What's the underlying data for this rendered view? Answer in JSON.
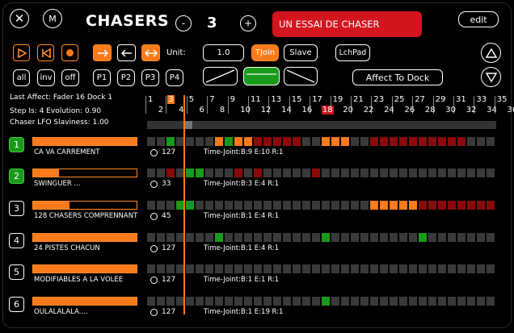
{
  "header": {
    "close_label": "✕",
    "m_label": "M",
    "title": "CHASERS",
    "minus_label": "-",
    "chaser_index": "3",
    "plus_label": "+",
    "chaser_name": "UN ESSAI DE CHASER",
    "edit_label": "edit"
  },
  "toolbar": {
    "unit_label": "Unit:",
    "unit_value": "1.0",
    "tjoin_label": "TJoin",
    "slave_label": "Slave",
    "lchpad_label": "LchPad",
    "all_label": "all",
    "inv_label": "inv",
    "off_label": "off",
    "p1_label": "P1",
    "p2_label": "P2",
    "p3_label": "P3",
    "p4_label": "P4",
    "affect_label": "Affect To Dock"
  },
  "info": {
    "last_affect": "Last Affect: Fader 16 Dock 1",
    "steps": "Step Is: 4   Evolution: 0.90",
    "lfo": "Chaser LFO Slaviness: 1.00"
  },
  "ruler": {
    "odd": [
      "1",
      "3",
      "5",
      "7",
      "9",
      "11",
      "13",
      "15",
      "17",
      "19",
      "21",
      "23",
      "25",
      "27",
      "29",
      "31",
      "33",
      "35"
    ],
    "even": [
      "2",
      "4",
      "6",
      "8",
      "10",
      "12",
      "14",
      "16",
      "18",
      "20",
      "22",
      "24",
      "26",
      "28",
      "30",
      "32",
      "34",
      "36"
    ],
    "highlight_odd": "3",
    "highlight_even": "18"
  },
  "colors": {
    "orange": "#ff7a1a",
    "green": "#1a9a1a",
    "dark_red": "#8a0a0a",
    "cell": "#3a3a3a",
    "red": "#d3151f"
  },
  "tracks": [
    {
      "num": "1",
      "name": "CA VA CARREMENT",
      "level": 1.0,
      "active": true,
      "dot_value": "127",
      "info": "Time-Joint:B:9 E:10 R:1",
      "cells": "..g....ogoorrrrr..ooo..rrrrrrrrrr..."
    },
    {
      "num": "2",
      "name": "SWINGUER ...",
      "level": 0.25,
      "active": true,
      "dot_value": "33",
      "info": "Time-Joint:B:3 E:4 R:1",
      "cells": "..r.gg...r.r.....r.................."
    },
    {
      "num": "3",
      "name": "128 CHASERS COMPRENNANT",
      "level": 0.35,
      "active": false,
      "dot_value": "45",
      "info": "Time-Joint:B:1 E:4 R:1",
      "cells": "...gg..................ooooorrrrrrrrr"
    },
    {
      "num": "4",
      "name": "24 PISTES CHACUN",
      "level": 1.0,
      "active": false,
      "dot_value": "127",
      "info": "Time-Joint:B:1 E:4 R:1",
      "cells": ".......g..........g.........g........"
    },
    {
      "num": "5",
      "name": "MODIFIABLES A LA VOLEE",
      "level": 1.0,
      "active": false,
      "dot_value": "127",
      "info": "Time-Joint:B:1 E:1 R:1",
      "cells": "...................................."
    },
    {
      "num": "6",
      "name": "OULALALALA....",
      "level": 1.0,
      "active": false,
      "dot_value": "127",
      "info": "Time-Joint:B:1 E:19 R:1",
      "cells": "..................g................."
    }
  ]
}
